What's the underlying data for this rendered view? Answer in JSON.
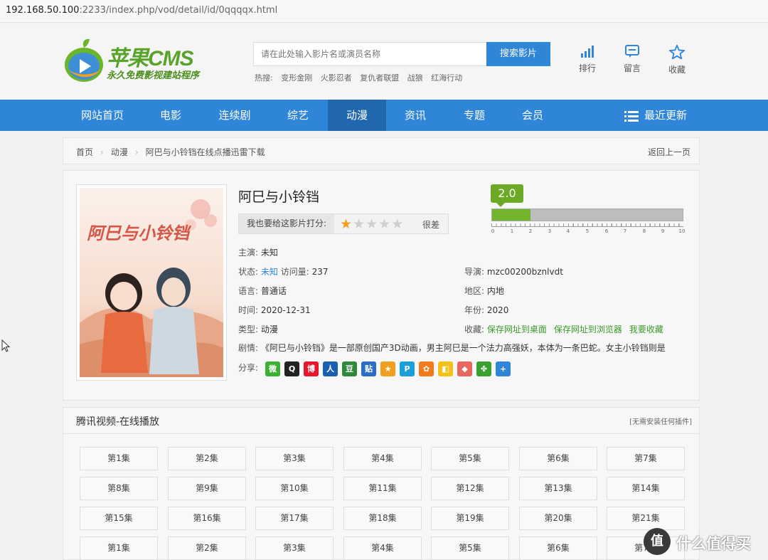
{
  "url": {
    "host": "192.168.50.100",
    "path": ":2233/index.php/vod/detail/id/0qqqqx.html"
  },
  "logo": {
    "title": "苹果CMS",
    "subtitle": "永久免费影视建站程序"
  },
  "search": {
    "placeholder": "请在此处输入影片名或演员名称",
    "button": "搜索影片"
  },
  "hot": {
    "label": "热搜:",
    "words": [
      "变形金刚",
      "火影忍者",
      "复仇者联盟",
      "战狼",
      "红海行动"
    ]
  },
  "header_icons": {
    "rank": "排行",
    "message": "留言",
    "favorite": "收藏"
  },
  "nav": {
    "items": [
      "网站首页",
      "电影",
      "连续剧",
      "综艺",
      "动漫",
      "资讯",
      "专题",
      "会员"
    ],
    "active_index": 4,
    "recent": "最近更新"
  },
  "breadcrumb": {
    "home": "首页",
    "category": "动漫",
    "current": "阿巴与小铃铛在线点播迅雷下载",
    "back": "返回上一页"
  },
  "detail": {
    "title": "阿巳与小铃铛",
    "poster_text": "阿巳与小铃铛",
    "rate_label": "我也要给这影片打分:",
    "stars_on": 1,
    "stars_total": 5,
    "rate_word": "很差",
    "score": "2.0",
    "score_fraction": 0.2,
    "score_ticks": [
      "0",
      "1",
      "2",
      "3",
      "4",
      "5",
      "6",
      "7",
      "8",
      "9",
      "10"
    ],
    "actor_k": "主演:",
    "actor_v": "未知",
    "status_k": "状态:",
    "status_v": "未知",
    "views_k": "访问量:",
    "views_v": "237",
    "director_k": "导演:",
    "director_v": "mzc00200bznlvdt",
    "lang_k": "语言:",
    "lang_v": "普通话",
    "area_k": "地区:",
    "area_v": "内地",
    "time_k": "时间:",
    "time_v": "2020-12-31",
    "year_k": "年份:",
    "year_v": "2020",
    "type_k": "类型:",
    "type_v": "动漫",
    "fav_k": "收藏:",
    "fav_links": [
      "保存网址到桌面",
      "保存网址到浏览器",
      "我要收藏"
    ],
    "plot_k": "剧情:",
    "plot_v": "《阿巳与小铃铛》是一部原创国产3D动画，男主阿巳是一个法力高强妖，本体为一条巴蛇。女主小铃铛则是",
    "share_k": "分享:"
  },
  "share_icons": [
    {
      "name": "wechat-icon",
      "color": "#3cb034",
      "glyph": "微"
    },
    {
      "name": "qq-icon",
      "color": "#222222",
      "glyph": "Q"
    },
    {
      "name": "weibo-icon",
      "color": "#e6162d",
      "glyph": "博"
    },
    {
      "name": "renren-icon",
      "color": "#1b5fb0",
      "glyph": "人"
    },
    {
      "name": "douban-icon",
      "color": "#2e8a3a",
      "glyph": "豆"
    },
    {
      "name": "tieba-icon",
      "color": "#2b6cc6",
      "glyph": "贴"
    },
    {
      "name": "qzone-icon",
      "color": "#f0a020",
      "glyph": "★"
    },
    {
      "name": "pinterest-icon",
      "color": "#1aa0d8",
      "glyph": "P"
    },
    {
      "name": "kaixin-icon",
      "color": "#f07a1e",
      "glyph": "✿"
    },
    {
      "name": "tsohu-icon",
      "color": "#f3c21a",
      "glyph": "◧"
    },
    {
      "name": "netease-icon",
      "color": "#e8675f",
      "glyph": "◆"
    },
    {
      "name": "clover-icon",
      "color": "#3aa02e",
      "glyph": "✤"
    },
    {
      "name": "more-share-icon",
      "color": "#2f86d8",
      "glyph": "+"
    }
  ],
  "episodes": {
    "title": "腾讯视频-在线播放",
    "note": "[无需安装任何插件]",
    "list": [
      "第1集",
      "第2集",
      "第3集",
      "第4集",
      "第5集",
      "第6集",
      "第7集",
      "第8集",
      "第9集",
      "第10集",
      "第11集",
      "第12集",
      "第13集",
      "第14集",
      "第15集",
      "第16集",
      "第17集",
      "第18集",
      "第19集",
      "第20集",
      "第21集",
      "第1集",
      "第2集",
      "第3集",
      "第4集",
      "第5集",
      "第6集",
      "第7集"
    ]
  },
  "watermark": {
    "badge": "值",
    "text": "什么值得买"
  },
  "colors": {
    "primary": "#2f86d8",
    "nav_active": "#2167ae",
    "green": "#6aaa24",
    "star": "#f0a020"
  }
}
